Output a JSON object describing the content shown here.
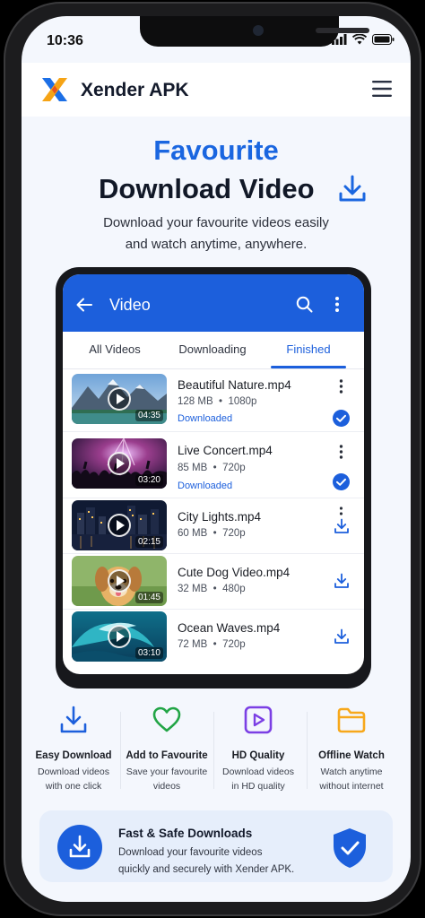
{
  "status_bar": {
    "time": "10:36"
  },
  "header": {
    "app_title": "Xender APK",
    "menu_icon": "hamburger-menu-icon"
  },
  "hero": {
    "title_line1": "Favourite",
    "title_line2": "Download Video",
    "subtitle_line1": "Download your favourite videos easily",
    "subtitle_line2": "and watch anytime, anywhere."
  },
  "video_app": {
    "title": "Video",
    "tabs": [
      {
        "label": "All Videos",
        "active": false
      },
      {
        "label": "Downloading",
        "active": false
      },
      {
        "label": "Finished",
        "active": true
      }
    ],
    "videos": [
      {
        "name": "Beautiful Nature.mp4",
        "size": "128 MB",
        "quality": "1080p",
        "duration": "04:35",
        "status": "Downloaded"
      },
      {
        "name": "Live Concert.mp4",
        "size": "85 MB",
        "quality": "720p",
        "duration": "03:20",
        "status": "Downloaded"
      },
      {
        "name": "City Lights.mp4",
        "size": "60 MB",
        "quality": "720p",
        "duration": "02:15",
        "status": ""
      },
      {
        "name": "Cute Dog Video.mp4",
        "size": "32 MB",
        "quality": "480p",
        "duration": "01:45",
        "status": ""
      },
      {
        "name": "Ocean Waves.mp4",
        "size": "72 MB",
        "quality": "720p",
        "duration": "03:10",
        "status": ""
      }
    ]
  },
  "features": [
    {
      "icon": "download-icon",
      "title": "Easy Download",
      "desc_line1": "Download videos",
      "desc_line2": "with one click"
    },
    {
      "icon": "heart-icon",
      "title": "Add to Favourite",
      "desc_line1": "Save your favourite",
      "desc_line2": "videos"
    },
    {
      "icon": "hd-play-icon",
      "title": "HD Quality",
      "desc_line1": "Download videos",
      "desc_line2": "in HD quality"
    },
    {
      "icon": "folder-icon",
      "title": "Offline Watch",
      "desc_line1": "Watch anytime",
      "desc_line2": "without internet"
    }
  ],
  "banner": {
    "title": "Fast & Safe Downloads",
    "desc_line1": "Download your favourite videos",
    "desc_line2": "quickly and securely with Xender APK."
  },
  "colors": {
    "accent": "#1c5fdc",
    "title_blue": "#1a66e0",
    "heart_green": "#22a546",
    "hd_purple": "#7b3fe4",
    "folder_orange": "#f7a81b"
  }
}
